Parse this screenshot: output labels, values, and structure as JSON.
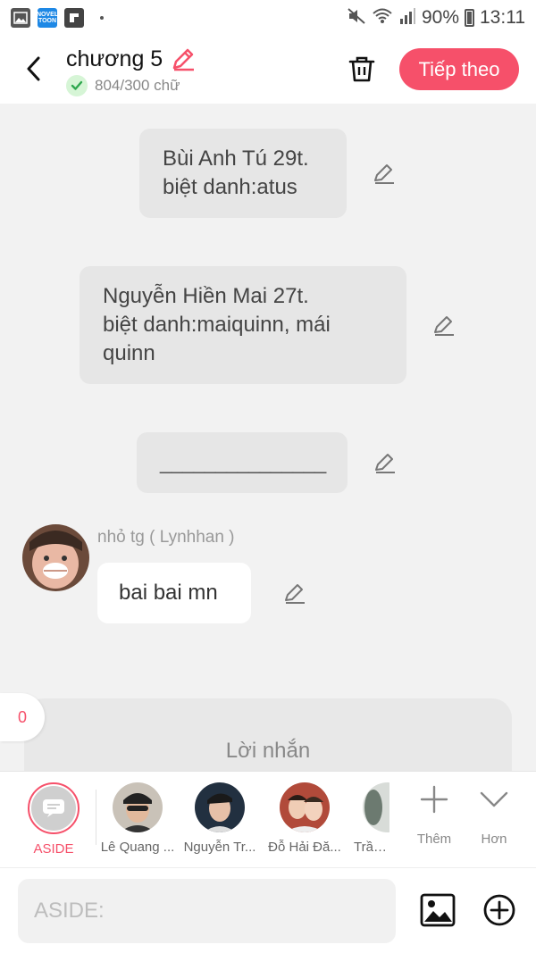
{
  "status_bar": {
    "battery": "90%",
    "time": "13:11",
    "novel_icon_label": "NOVEL TOON"
  },
  "header": {
    "title": "chương 5",
    "word_count": "804/300 chữ",
    "next_label": "Tiếp theo"
  },
  "messages": [
    {
      "text": "Bùi Anh Tú 29t.\nbiệt danh:atus"
    },
    {
      "text": "Nguyễn Hiền Mai 27t.\nbiệt danh:maiquinn, mái quinn"
    },
    {
      "text": "_______________"
    }
  ],
  "speaker_message": {
    "speaker": "nhỏ tg ( Lynhhan )",
    "text": "bai bai mn"
  },
  "comment": {
    "count": "0",
    "label": "Lời nhắn"
  },
  "characters": [
    {
      "name": "ASIDE"
    },
    {
      "name": "Lê Quang ..."
    },
    {
      "name": "Nguyễn Tr..."
    },
    {
      "name": "Đỗ Hải Đă..."
    },
    {
      "name": "Trần M"
    }
  ],
  "tools": {
    "more_label": "Thêm",
    "less_label": "Hơn"
  },
  "input": {
    "placeholder": "ASIDE:"
  },
  "colors": {
    "accent": "#f6506a",
    "bubble": "#e6e6e6",
    "background": "#f2f2f2"
  }
}
